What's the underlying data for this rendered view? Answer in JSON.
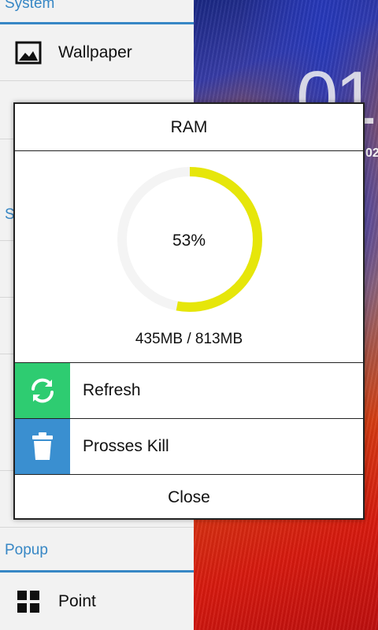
{
  "settings": {
    "system_section": "System",
    "wallpaper_label": "Wallpaper",
    "popup_section": "Popup",
    "point_label": "Point",
    "s_partial": "S"
  },
  "wallpaper": {
    "clock_digits": "01",
    "clock_small": "02"
  },
  "dialog": {
    "title": "RAM",
    "usage_percent_text": "53%",
    "usage_fraction": 0.53,
    "usage_text": "435MB / 813MB",
    "refresh_label": "Refresh",
    "kill_label": "Prosses Kill",
    "close_label": "Close",
    "colors": {
      "gauge_fill": "#e6e60a",
      "gauge_track": "#f4f4f4",
      "refresh_bg": "#2ecc71",
      "kill_bg": "#3a8fd0"
    },
    "icons": {
      "refresh": "refresh-icon",
      "kill": "trash-icon"
    }
  },
  "icons": {
    "wallpaper": "image-icon",
    "point": "grid-icon"
  }
}
